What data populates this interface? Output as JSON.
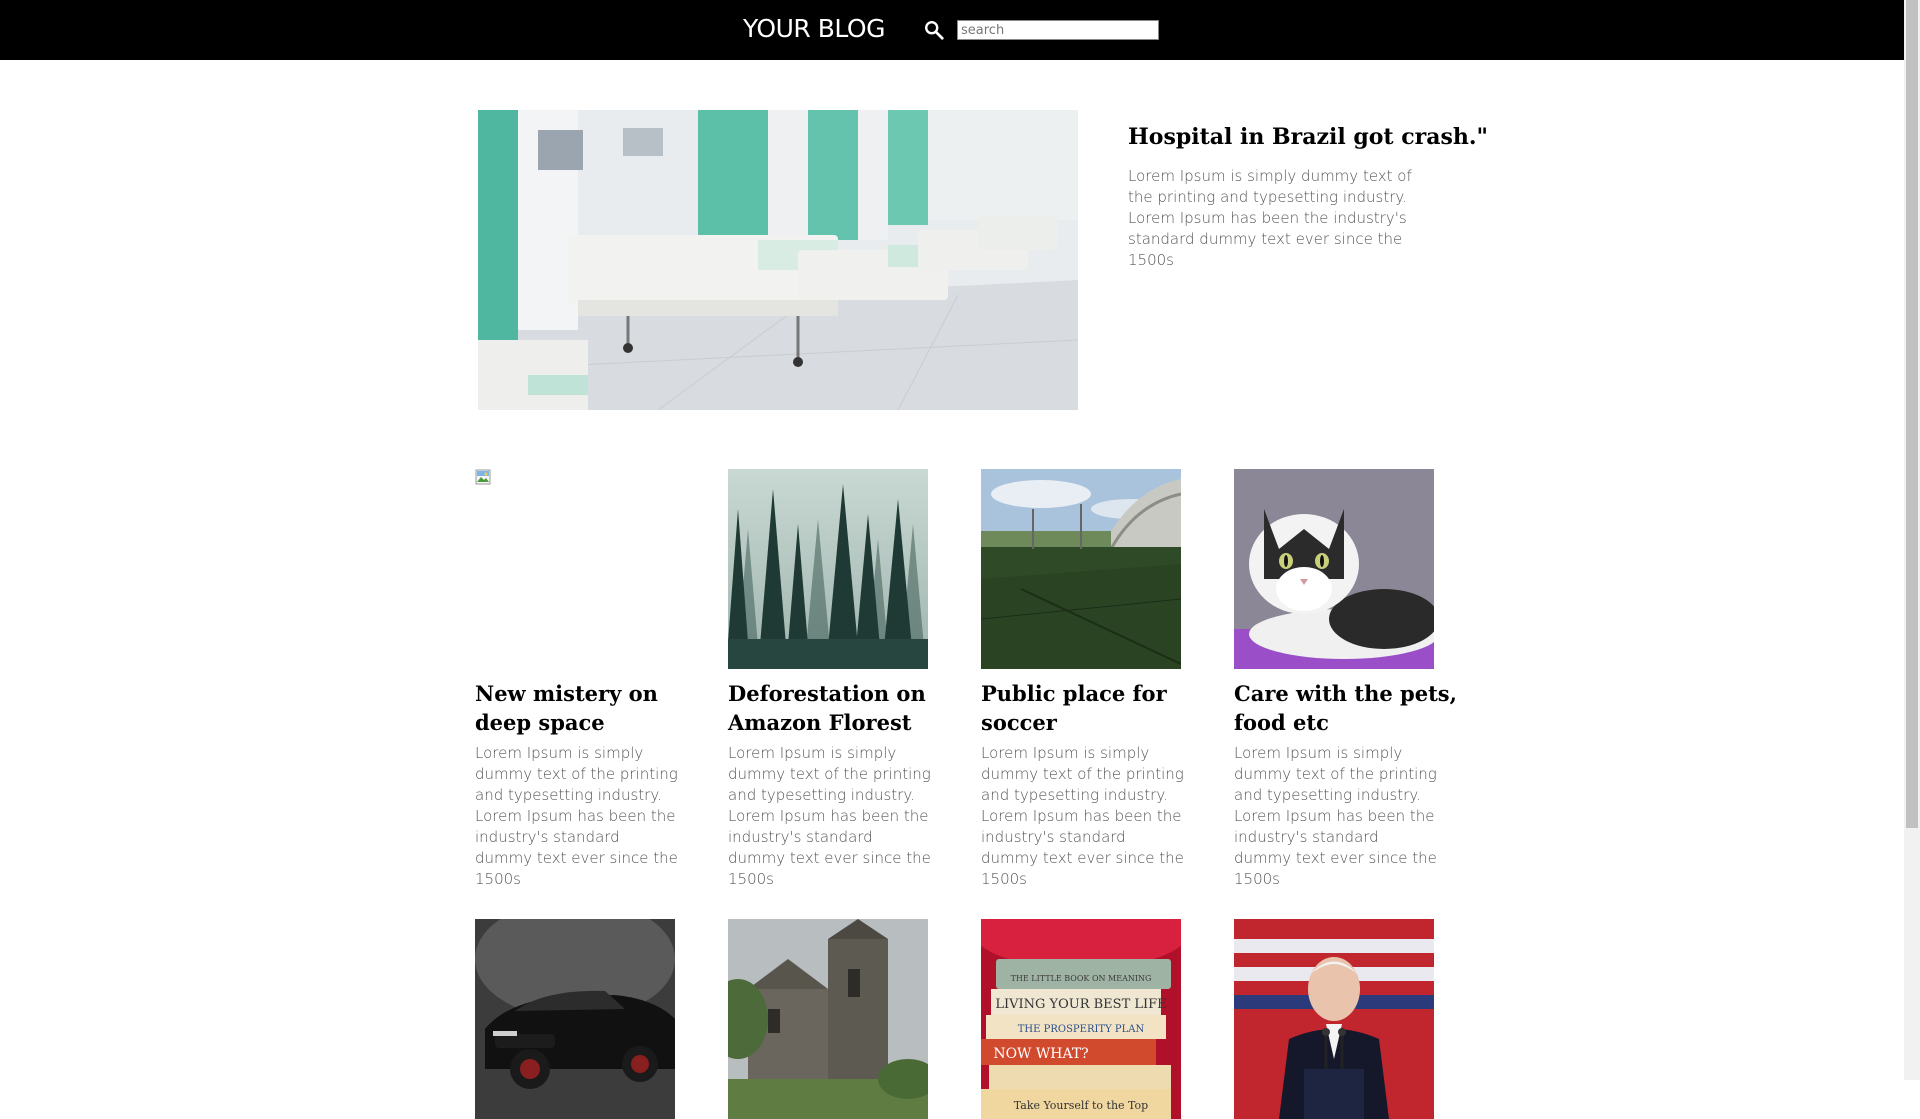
{
  "header": {
    "brand": "YOUR BLOG",
    "search_placeholder": "search",
    "search_icon": "magnifier-icon"
  },
  "featured": {
    "title": "Hospital in Brazil got crash.\"",
    "text": "Lorem Ipsum is simply dummy text of the printing and typesetting industry. Lorem Ipsum has been the industry's standard dummy text ever since the 1500s",
    "image": "hospital-ward-photo"
  },
  "posts": [
    {
      "title": "New mistery on deep space",
      "text": "Lorem Ipsum is simply dummy text of the printing and typesetting industry. Lorem Ipsum has been the industry's standard dummy text ever since the 1500s",
      "image": "broken-image-icon"
    },
    {
      "title": "Deforestation on Amazon Florest",
      "text": "Lorem Ipsum is simply dummy text of the printing and typesetting industry. Lorem Ipsum has been the industry's standard dummy text ever since the 1500s",
      "image": "misty-forest-photo"
    },
    {
      "title": "Public place for soccer",
      "text": "Lorem Ipsum is simply dummy text of the printing and typesetting industry. Lorem Ipsum has been the industry's standard dummy text ever since the 1500s",
      "image": "soccer-field-photo"
    },
    {
      "title": "Care with the pets, food etc",
      "text": "Lorem Ipsum is simply dummy text of the printing and typesetting industry. Lorem Ipsum has been the industry's standard dummy text ever since the 1500s",
      "image": "cat-photo"
    }
  ],
  "more_posts": [
    {
      "image": "black-car-photo"
    },
    {
      "image": "stone-church-photo"
    },
    {
      "image": "book-stack-photo",
      "book_lines": [
        "THE LITTLE BOOK ON MEANING",
        "LIVING YOUR BEST LIFE",
        "THE PROSPERITY PLAN",
        "NOW WHAT?",
        "Take Yourself to the Top"
      ]
    },
    {
      "image": "speaker-at-podium-photo"
    }
  ],
  "colors": {
    "header_bg": "#000000",
    "page_bg": "#ffffff",
    "body_text": "#555555",
    "title_text": "#000000"
  }
}
